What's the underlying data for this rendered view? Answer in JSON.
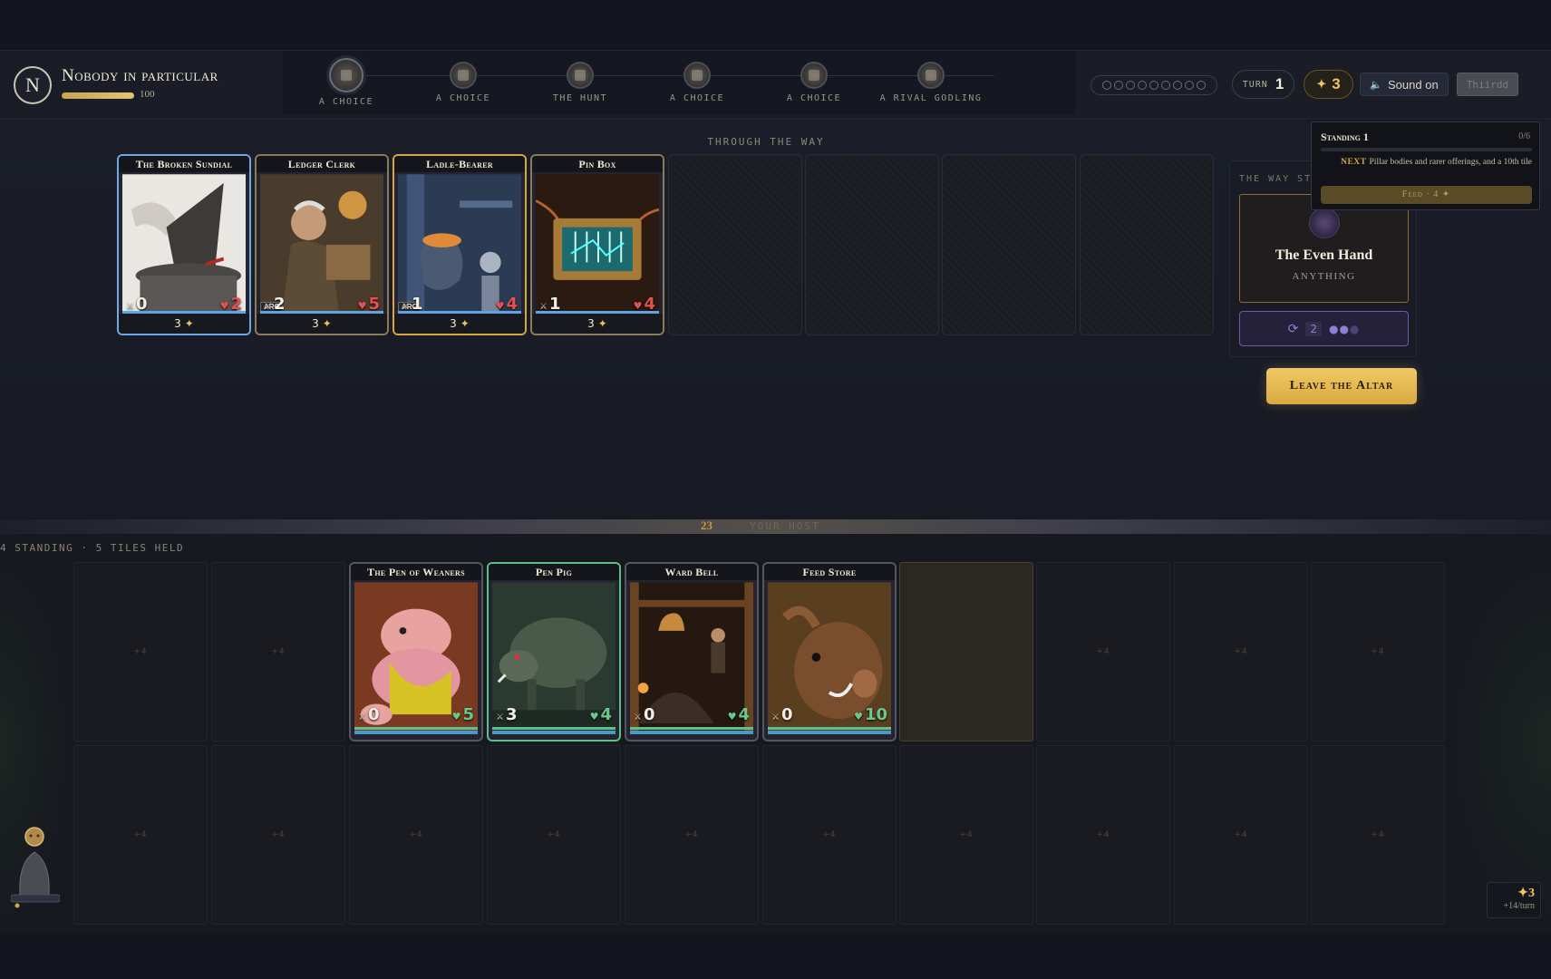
{
  "player": {
    "initial": "N",
    "name": "Nobody in particular",
    "hp_text": "100",
    "hp_fraction": 1.0
  },
  "path": {
    "nodes": [
      {
        "label": "A CHOICE",
        "active": true,
        "icon": "book-icon"
      },
      {
        "label": "A CHOICE",
        "active": false,
        "icon": "book-icon"
      },
      {
        "label": "THE HUNT",
        "active": false,
        "icon": "beast-icon"
      },
      {
        "label": "A CHOICE",
        "active": false,
        "icon": "book-icon"
      },
      {
        "label": "A CHOICE",
        "active": false,
        "icon": "book-icon"
      },
      {
        "label": "A RIVAL GODLING",
        "active": false,
        "icon": "rival-icon"
      }
    ]
  },
  "status": {
    "pips": 9,
    "turn_label": "TURN",
    "turn_value": "1",
    "favor_star": "✦",
    "favor_value": "3",
    "sound_label": "Sound on",
    "third_label": "Thiirdd"
  },
  "altar": {
    "section_label": "THROUGH THE WAY",
    "cards": [
      {
        "title": "The Broken Sundial",
        "atk": "0",
        "hp": "2",
        "cost": "3",
        "arc": false,
        "border": "blue",
        "art": "sundial"
      },
      {
        "title": "Ledger Clerk",
        "atk": "2",
        "hp": "5",
        "cost": "3",
        "arc": true,
        "border": "default",
        "art": "clerk"
      },
      {
        "title": "Ladle-Bearer",
        "atk": "1",
        "hp": "4",
        "cost": "3",
        "arc": true,
        "border": "gold",
        "art": "ladle"
      },
      {
        "title": "Pin Box",
        "atk": "1",
        "hp": "4",
        "cost": "3",
        "arc": false,
        "border": "default",
        "art": "pinbox"
      }
    ],
    "empty_slots": 4,
    "arc_label": "ARC"
  },
  "way_panel": {
    "label": "THE WAY ST",
    "god_name": "The Even Hand",
    "god_sub": "ANYTHING",
    "reroll_count": "2",
    "reroll_icon": "refresh-icon"
  },
  "leave_button": "Leave the Altar",
  "tooltip": {
    "title": "Standing 1",
    "count": "0/6",
    "next_label": "NEXT",
    "next_text": "Pillar bodies and rarer offerings, and a 10th tile",
    "feed_label": "Feed · 4 ✦"
  },
  "host": {
    "count": "23",
    "label": "YOUR HOST",
    "standing_label": "4 STANDING · 5 TILES HELD",
    "tile_mark": "+4",
    "cards": [
      {
        "title": "The Pen of Weaners",
        "atk": "0",
        "hp": "5",
        "col": 2,
        "art": "weaners",
        "border": "default"
      },
      {
        "title": "Pen Pig",
        "atk": "3",
        "hp": "4",
        "col": 3,
        "art": "penpig",
        "border": "green"
      },
      {
        "title": "Ward Bell",
        "atk": "0",
        "hp": "4",
        "col": 4,
        "art": "wardbell",
        "border": "default"
      },
      {
        "title": "Feed Store",
        "atk": "0",
        "hp": "10",
        "col": 5,
        "art": "feedstore",
        "border": "default"
      }
    ],
    "highlight_col": 6
  },
  "resources": {
    "value": "✦3",
    "rate": "+14/turn"
  },
  "colors": {
    "gold": "#d6a643",
    "blue": "#6ea8e6",
    "green": "#5fbf87",
    "hp_red": "#e5504e"
  }
}
